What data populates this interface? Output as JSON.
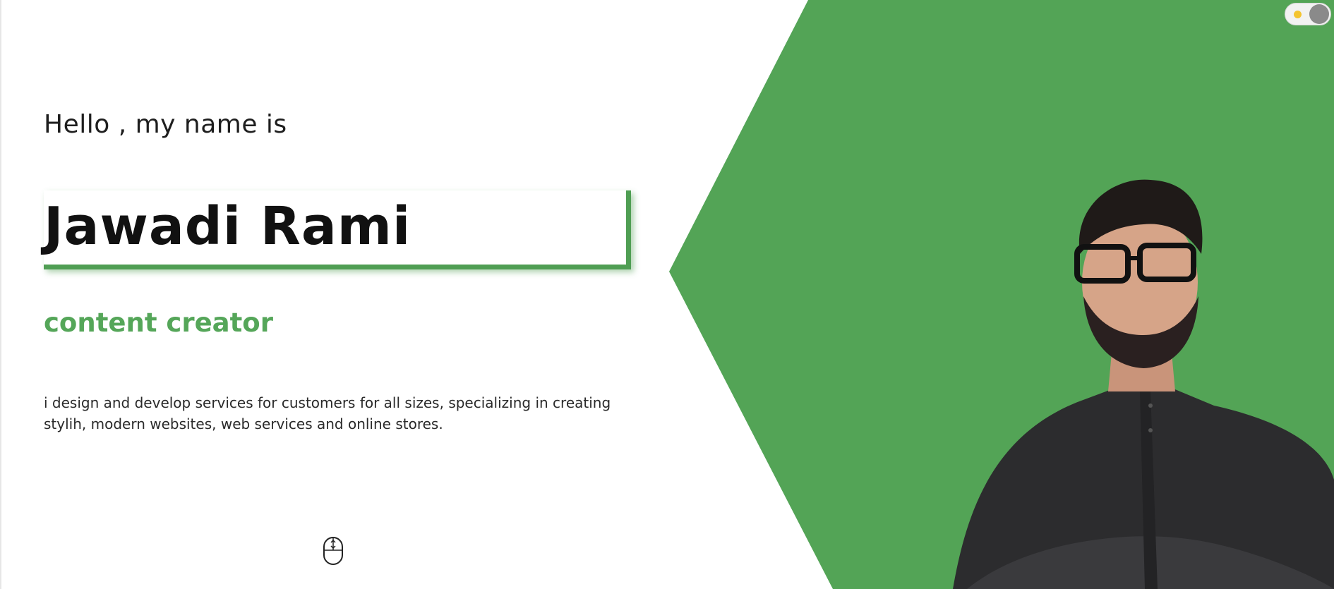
{
  "hero": {
    "greeting": "Hello , my name is",
    "name": "Jawadi Rami",
    "role": "content creator",
    "description": "i design and develop services for customers for all sizes, specializing in creating stylih, modern websites, web services and online stores."
  },
  "icons": {
    "scroll": "mouse-scroll-icon",
    "theme": "theme-toggle-icon"
  },
  "colors": {
    "accent": "#55a659",
    "green_panel": "#53a456",
    "text": "#1e1e1e"
  }
}
